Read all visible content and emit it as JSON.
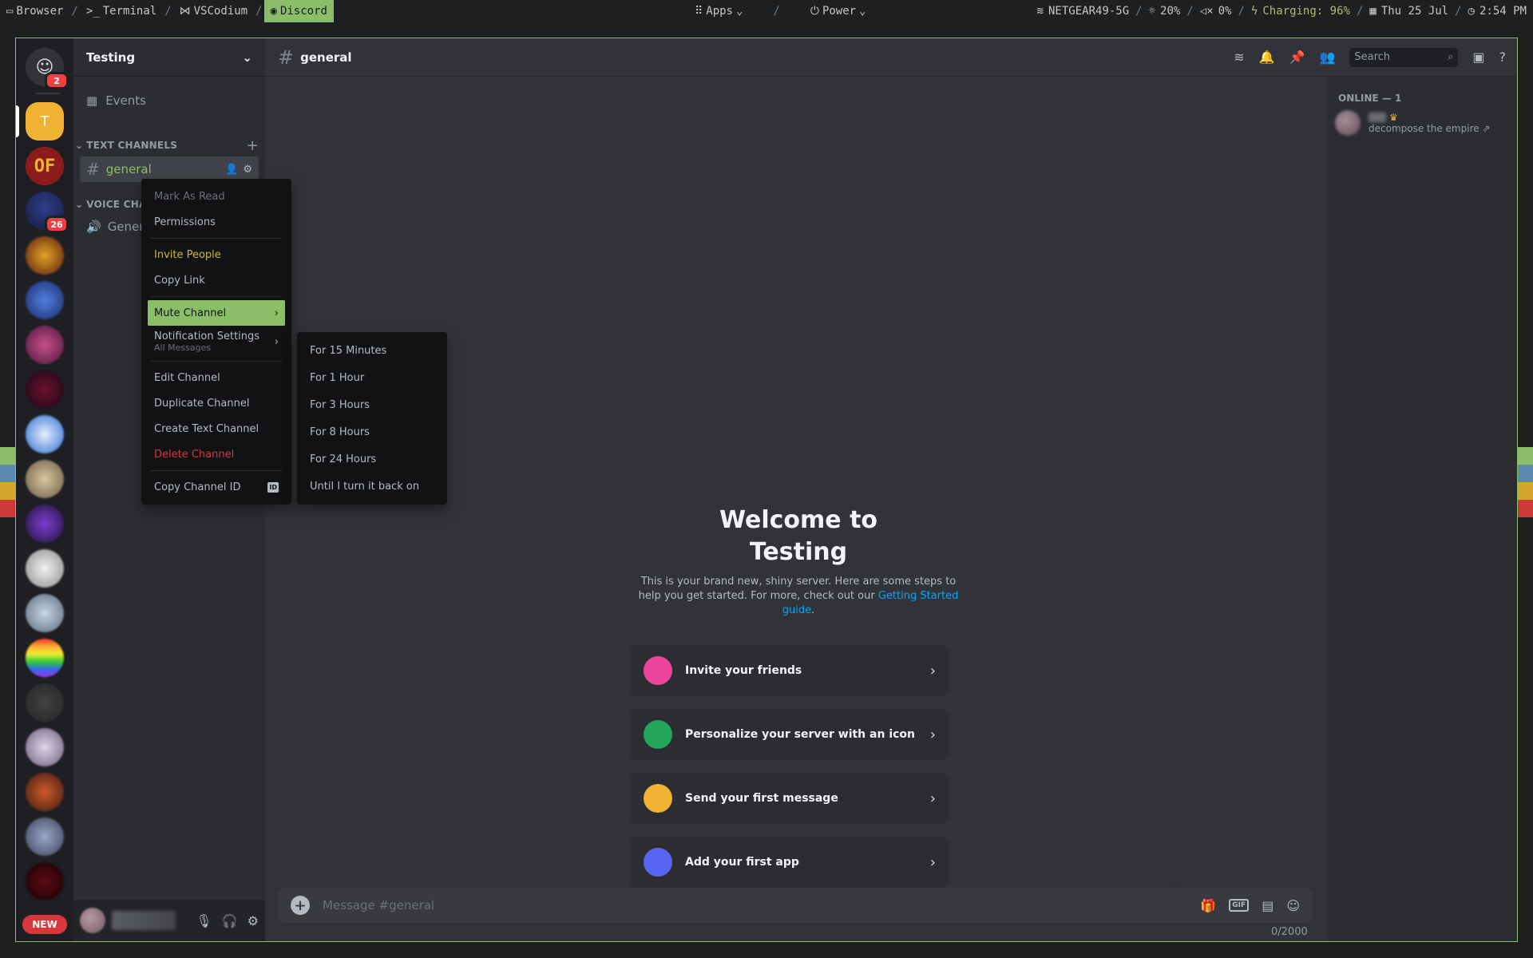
{
  "topbar": {
    "workspaces": [
      "Browser",
      "Terminal",
      "VSCodium",
      "Discord"
    ],
    "center": [
      "Apps",
      "Power"
    ],
    "network": "NETGEAR49-5G",
    "brightness": "20%",
    "volume": "0%",
    "battery": "Charging: 96%",
    "date": "Thu 25 Jul",
    "time": "2:54 PM"
  },
  "rail": {
    "home_badge": "2",
    "active_server_letter": "T",
    "server2_text": "OF",
    "server3_badge": "26",
    "new_label": "NEW"
  },
  "sidebar": {
    "guild_name": "Testing",
    "events_label": "Events",
    "text_category": "TEXT CHANNELS",
    "voice_category": "VOICE CHANN",
    "channel_general": "general",
    "voice_general": "Gener"
  },
  "context_menu": {
    "items": [
      "Mark As Read",
      "Permissions",
      "Invite People",
      "Copy Link",
      "Mute Channel",
      "Notification Settings",
      "Edit Channel",
      "Duplicate Channel",
      "Create Text Channel",
      "Delete Channel",
      "Copy Channel ID"
    ],
    "notification_sub": "All Messages",
    "id_badge": "ID"
  },
  "mute_submenu": {
    "items": [
      "For 15 Minutes",
      "For 1 Hour",
      "For 3 Hours",
      "For 8 Hours",
      "For 24 Hours",
      "Until I turn it back on"
    ]
  },
  "header": {
    "channel_name": "general",
    "search_placeholder": "Search"
  },
  "members": {
    "online_header": "ONLINE — 1",
    "member_status": "decompose the empire ⇗"
  },
  "welcome": {
    "title_line1": "Welcome to",
    "title_line2": "Testing",
    "body": "This is your brand new, shiny server. Here are some steps to help you get started. For more, check out our",
    "link": "Getting Started guide",
    "period": ".",
    "cards": [
      "Invite your friends",
      "Personalize your server with an icon",
      "Send your first message",
      "Add your first app"
    ]
  },
  "composer": {
    "placeholder": "Message #general",
    "null_text": "null",
    "counter": "0/2000"
  },
  "colors": {
    "accent_green": "#8abe69",
    "danger": "#da373c",
    "invite_yellow": "#c9b840",
    "link_blue": "#00a8fc"
  }
}
